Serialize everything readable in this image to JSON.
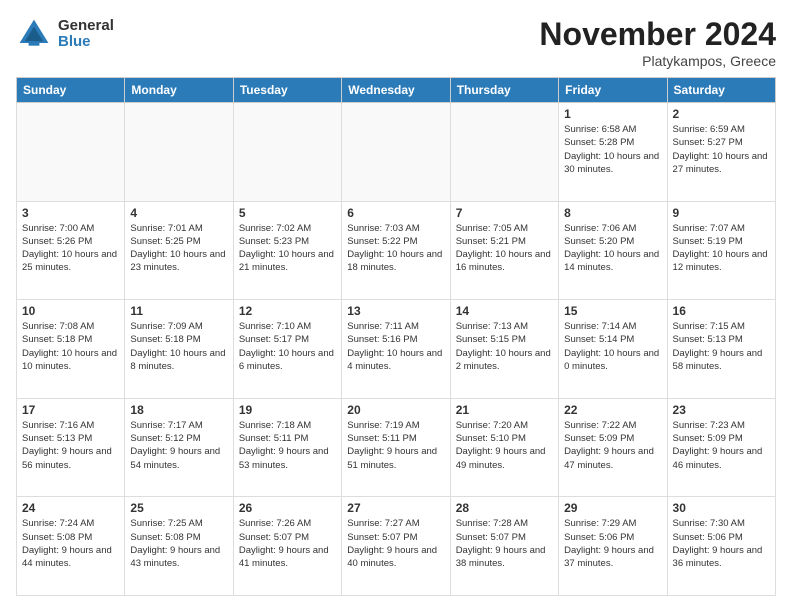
{
  "logo": {
    "general": "General",
    "blue": "Blue"
  },
  "header": {
    "month": "November 2024",
    "location": "Platykampos, Greece"
  },
  "weekdays": [
    "Sunday",
    "Monday",
    "Tuesday",
    "Wednesday",
    "Thursday",
    "Friday",
    "Saturday"
  ],
  "weeks": [
    [
      {
        "day": "",
        "info": ""
      },
      {
        "day": "",
        "info": ""
      },
      {
        "day": "",
        "info": ""
      },
      {
        "day": "",
        "info": ""
      },
      {
        "day": "",
        "info": ""
      },
      {
        "day": "1",
        "info": "Sunrise: 6:58 AM\nSunset: 5:28 PM\nDaylight: 10 hours and 30 minutes."
      },
      {
        "day": "2",
        "info": "Sunrise: 6:59 AM\nSunset: 5:27 PM\nDaylight: 10 hours and 27 minutes."
      }
    ],
    [
      {
        "day": "3",
        "info": "Sunrise: 7:00 AM\nSunset: 5:26 PM\nDaylight: 10 hours and 25 minutes."
      },
      {
        "day": "4",
        "info": "Sunrise: 7:01 AM\nSunset: 5:25 PM\nDaylight: 10 hours and 23 minutes."
      },
      {
        "day": "5",
        "info": "Sunrise: 7:02 AM\nSunset: 5:23 PM\nDaylight: 10 hours and 21 minutes."
      },
      {
        "day": "6",
        "info": "Sunrise: 7:03 AM\nSunset: 5:22 PM\nDaylight: 10 hours and 18 minutes."
      },
      {
        "day": "7",
        "info": "Sunrise: 7:05 AM\nSunset: 5:21 PM\nDaylight: 10 hours and 16 minutes."
      },
      {
        "day": "8",
        "info": "Sunrise: 7:06 AM\nSunset: 5:20 PM\nDaylight: 10 hours and 14 minutes."
      },
      {
        "day": "9",
        "info": "Sunrise: 7:07 AM\nSunset: 5:19 PM\nDaylight: 10 hours and 12 minutes."
      }
    ],
    [
      {
        "day": "10",
        "info": "Sunrise: 7:08 AM\nSunset: 5:18 PM\nDaylight: 10 hours and 10 minutes."
      },
      {
        "day": "11",
        "info": "Sunrise: 7:09 AM\nSunset: 5:18 PM\nDaylight: 10 hours and 8 minutes."
      },
      {
        "day": "12",
        "info": "Sunrise: 7:10 AM\nSunset: 5:17 PM\nDaylight: 10 hours and 6 minutes."
      },
      {
        "day": "13",
        "info": "Sunrise: 7:11 AM\nSunset: 5:16 PM\nDaylight: 10 hours and 4 minutes."
      },
      {
        "day": "14",
        "info": "Sunrise: 7:13 AM\nSunset: 5:15 PM\nDaylight: 10 hours and 2 minutes."
      },
      {
        "day": "15",
        "info": "Sunrise: 7:14 AM\nSunset: 5:14 PM\nDaylight: 10 hours and 0 minutes."
      },
      {
        "day": "16",
        "info": "Sunrise: 7:15 AM\nSunset: 5:13 PM\nDaylight: 9 hours and 58 minutes."
      }
    ],
    [
      {
        "day": "17",
        "info": "Sunrise: 7:16 AM\nSunset: 5:13 PM\nDaylight: 9 hours and 56 minutes."
      },
      {
        "day": "18",
        "info": "Sunrise: 7:17 AM\nSunset: 5:12 PM\nDaylight: 9 hours and 54 minutes."
      },
      {
        "day": "19",
        "info": "Sunrise: 7:18 AM\nSunset: 5:11 PM\nDaylight: 9 hours and 53 minutes."
      },
      {
        "day": "20",
        "info": "Sunrise: 7:19 AM\nSunset: 5:11 PM\nDaylight: 9 hours and 51 minutes."
      },
      {
        "day": "21",
        "info": "Sunrise: 7:20 AM\nSunset: 5:10 PM\nDaylight: 9 hours and 49 minutes."
      },
      {
        "day": "22",
        "info": "Sunrise: 7:22 AM\nSunset: 5:09 PM\nDaylight: 9 hours and 47 minutes."
      },
      {
        "day": "23",
        "info": "Sunrise: 7:23 AM\nSunset: 5:09 PM\nDaylight: 9 hours and 46 minutes."
      }
    ],
    [
      {
        "day": "24",
        "info": "Sunrise: 7:24 AM\nSunset: 5:08 PM\nDaylight: 9 hours and 44 minutes."
      },
      {
        "day": "25",
        "info": "Sunrise: 7:25 AM\nSunset: 5:08 PM\nDaylight: 9 hours and 43 minutes."
      },
      {
        "day": "26",
        "info": "Sunrise: 7:26 AM\nSunset: 5:07 PM\nDaylight: 9 hours and 41 minutes."
      },
      {
        "day": "27",
        "info": "Sunrise: 7:27 AM\nSunset: 5:07 PM\nDaylight: 9 hours and 40 minutes."
      },
      {
        "day": "28",
        "info": "Sunrise: 7:28 AM\nSunset: 5:07 PM\nDaylight: 9 hours and 38 minutes."
      },
      {
        "day": "29",
        "info": "Sunrise: 7:29 AM\nSunset: 5:06 PM\nDaylight: 9 hours and 37 minutes."
      },
      {
        "day": "30",
        "info": "Sunrise: 7:30 AM\nSunset: 5:06 PM\nDaylight: 9 hours and 36 minutes."
      }
    ]
  ]
}
